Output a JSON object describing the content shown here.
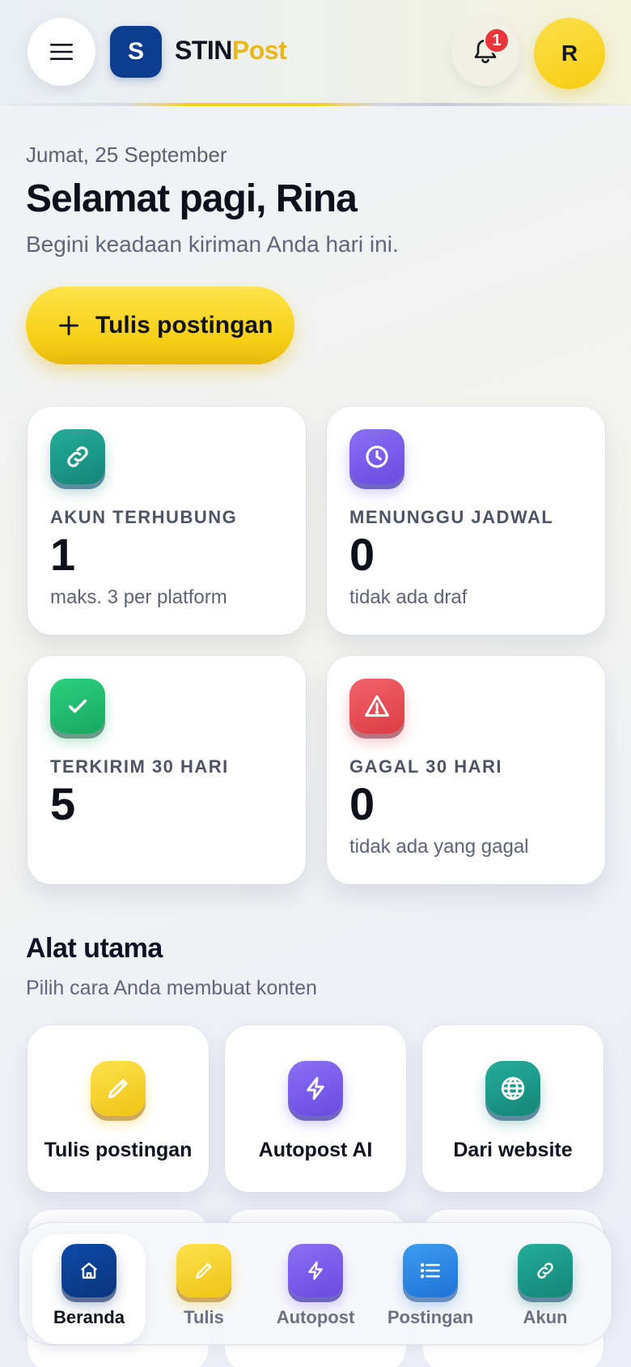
{
  "header": {
    "logo_letter": "S",
    "brand_part1": "STIN",
    "brand_part2": "Post",
    "notification_count": "1",
    "avatar_initial": "R"
  },
  "intro": {
    "date": "Jumat, 25 September",
    "greeting": "Selamat pagi, Rina",
    "subtitle": "Begini keadaan kiriman Anda hari ini.",
    "write_button": "Tulis postingan"
  },
  "stats": [
    {
      "label": "AKUN TERHUBUNG",
      "value": "1",
      "note": "maks. 3 per platform",
      "icon": "link-icon",
      "color": "#1a9886"
    },
    {
      "label": "MENUNGGU JADWAL",
      "value": "0",
      "note": "tidak ada draf",
      "icon": "clock-icon",
      "color": "#7a5cec"
    },
    {
      "label": "TERKIRIM 30 HARI",
      "value": "5",
      "note": "",
      "icon": "check-icon",
      "color": "#1fbb70"
    },
    {
      "label": "GAGAL 30 HARI",
      "value": "0",
      "note": "tidak ada yang gagal",
      "icon": "warning-icon",
      "color": "#e5484f"
    }
  ],
  "tools_section": {
    "title": "Alat utama",
    "subtitle": "Pilih cara Anda membuat konten",
    "items": [
      {
        "label": "Tulis postingan",
        "icon": "pencil-icon",
        "color": "#f4cf1f"
      },
      {
        "label": "Autopost AI",
        "icon": "lightning-icon",
        "color": "#7a5cec"
      },
      {
        "label": "Dari website",
        "icon": "globe-icon",
        "color": "#1a9886"
      }
    ]
  },
  "bottom_nav": {
    "items": [
      {
        "label": "Beranda",
        "icon": "home-icon",
        "active": true
      },
      {
        "label": "Tulis",
        "icon": "pencil-icon"
      },
      {
        "label": "Autopost",
        "icon": "lightning-icon"
      },
      {
        "label": "Postingan",
        "icon": "list-icon"
      },
      {
        "label": "Akun",
        "icon": "link-icon"
      }
    ]
  }
}
